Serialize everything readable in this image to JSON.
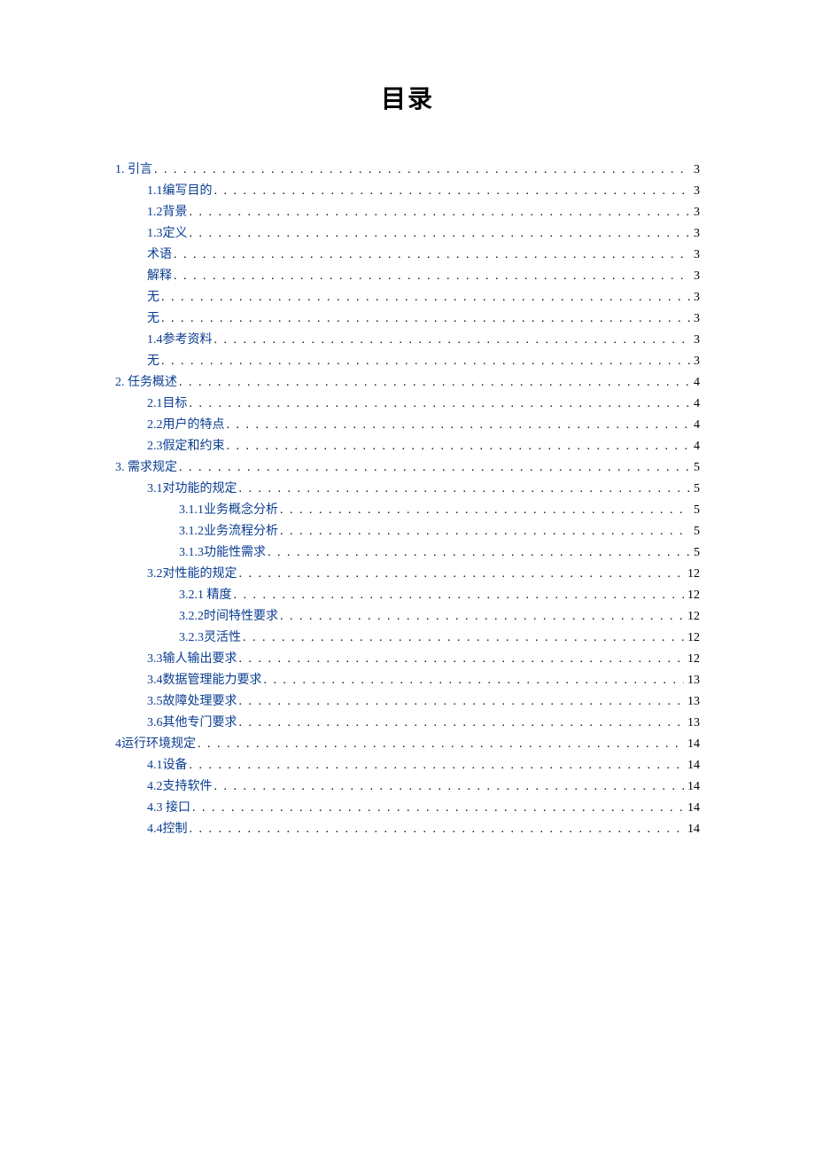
{
  "title": "目录",
  "entries": [
    {
      "level": 1,
      "label": "1.  引言",
      "page": "3",
      "link": true
    },
    {
      "level": 2,
      "label": "1.1编写目的",
      "page": "3",
      "link": true
    },
    {
      "level": 2,
      "label": "1.2背景",
      "page": "3",
      "link": true
    },
    {
      "level": 2,
      "label": "1.3定义",
      "page": "3",
      "link": true
    },
    {
      "level": 2,
      "label": "术语",
      "page": "3",
      "link": true
    },
    {
      "level": 2,
      "label": "解释",
      "page": "3",
      "link": true
    },
    {
      "level": 2,
      "label": "无",
      "page": "3",
      "link": true
    },
    {
      "level": 2,
      "label": "无",
      "page": "3",
      "link": true
    },
    {
      "level": 2,
      "label": "1.4参考资料",
      "page": "3",
      "link": true
    },
    {
      "level": 2,
      "label": "无",
      "page": "3",
      "link": true
    },
    {
      "level": 1,
      "label": "2.  任务概述",
      "page": "4",
      "link": true
    },
    {
      "level": 2,
      "label": "2.1目标",
      "page": "4",
      "link": true
    },
    {
      "level": 2,
      "label": "2.2用户的特点",
      "page": "4",
      "link": true
    },
    {
      "level": 2,
      "label": "2.3假定和约束",
      "page": "4",
      "link": true
    },
    {
      "level": 1,
      "label": "3.  需求规定",
      "page": "5",
      "link": true
    },
    {
      "level": 2,
      "label": "3.1对功能的规定",
      "page": "5",
      "link": true
    },
    {
      "level": 3,
      "label": "3.1.1业务概念分析",
      "page": "5",
      "link": true
    },
    {
      "level": 3,
      "label": "3.1.2业务流程分析",
      "page": "5",
      "link": true
    },
    {
      "level": 3,
      "label": "3.1.3功能性需求",
      "page": "5",
      "link": true
    },
    {
      "level": 2,
      "label": "3.2对性能的规定",
      "page": "12",
      "link": true
    },
    {
      "level": 3,
      "label": "3.2.1 精度",
      "page": "12",
      "link": true
    },
    {
      "level": 3,
      "label": "3.2.2时间特性要求",
      "page": "12",
      "link": true
    },
    {
      "level": 3,
      "label": "3.2.3灵活性",
      "page": "12",
      "link": true
    },
    {
      "level": 2,
      "label": "3.3输人输出要求",
      "page": "12",
      "link": true
    },
    {
      "level": 2,
      "label": "3.4数据管理能力要求",
      "page": "13",
      "link": true
    },
    {
      "level": 2,
      "label": "3.5故障处理要求",
      "page": "13",
      "link": true
    },
    {
      "level": 2,
      "label": "3.6其他专门要求",
      "page": "13",
      "link": true
    },
    {
      "level": 1,
      "label": "4运行环境规定",
      "page": "14",
      "link": true
    },
    {
      "level": 2,
      "label": "4.1设备",
      "page": "14",
      "link": true
    },
    {
      "level": 2,
      "label": "4.2支持软件",
      "page": "14",
      "link": true
    },
    {
      "level": 2,
      "label": "4.3 接口",
      "page": "14",
      "link": true
    },
    {
      "level": 2,
      "label": "4.4控制",
      "page": "14",
      "link": true
    }
  ]
}
